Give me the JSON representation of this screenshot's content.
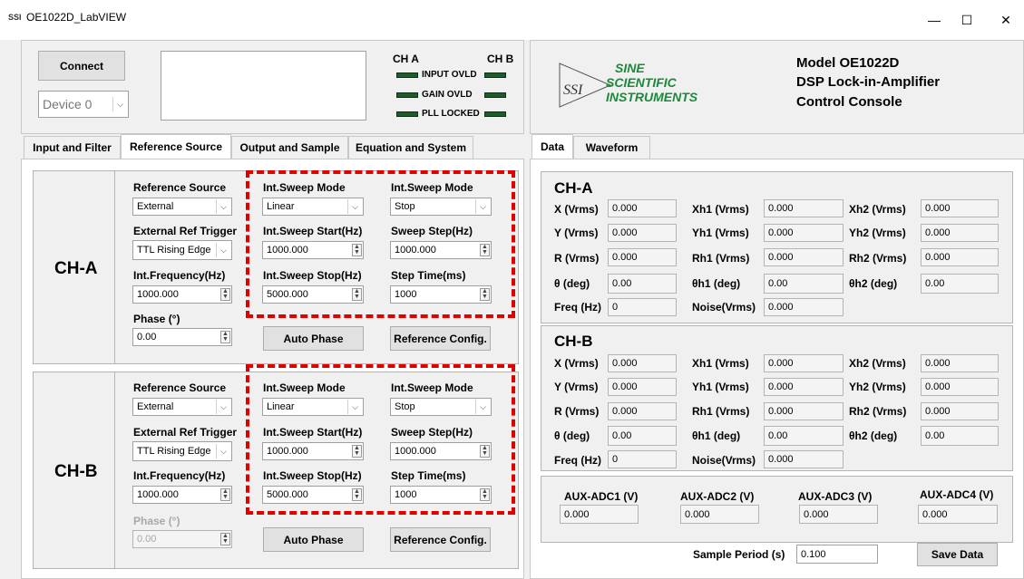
{
  "window": {
    "icon_text": "SSI",
    "title": "OE1022D_LabVIEW",
    "minimize": "—",
    "maximize": "☐",
    "close": "✕"
  },
  "connection": {
    "connect_label": "Connect",
    "device_value": "Device 0"
  },
  "indicators": {
    "ch_a": "CH A",
    "ch_b": "CH B",
    "items": [
      "INPUT OVLD",
      "GAIN OVLD",
      "PLL LOCKED"
    ]
  },
  "brand": {
    "logo_mark": "SSI",
    "line1": "SINE",
    "line2": "SCIENTIFIC",
    "line3": "INSTRUMENTS",
    "model": "Model OE1022D",
    "desc": "DSP Lock-in-Amplifier",
    "console": "Control Console"
  },
  "left_tabs": [
    "Input and Filter",
    "Reference Source",
    "Output and Sample",
    "Equation and System"
  ],
  "right_tabs": [
    "Data",
    "Waveform"
  ],
  "reference": {
    "labels": {
      "ref_source": "Reference Source",
      "ext_trigger": "External Ref Trigger",
      "int_freq": "Int.Frequency(Hz)",
      "phase": "Phase (°)",
      "sweep_mode": "Int.Sweep Mode",
      "sweep_start": "Int.Sweep Start(Hz)",
      "sweep_stop": "Int.Sweep Stop(Hz)",
      "sweep_step": "Sweep Step(Hz)",
      "step_time": "Step Time(ms)",
      "auto_phase": "Auto Phase",
      "ref_config": "Reference Config."
    },
    "channels": [
      {
        "name": "CH-A",
        "ref_source": "External",
        "ext_trigger": "TTL Rising Edge",
        "int_freq": "1000.000",
        "phase": "0.00",
        "sweep_mode1": "Linear",
        "sweep_mode2": "Stop",
        "sweep_start": "1000.000",
        "sweep_step": "1000.000",
        "sweep_stop": "5000.000",
        "step_time": "1000"
      },
      {
        "name": "CH-B",
        "ref_source": "External",
        "ext_trigger": "TTL Rising Edge",
        "int_freq": "1000.000",
        "phase": "0.00",
        "sweep_mode1": "Linear",
        "sweep_mode2": "Stop",
        "sweep_start": "1000.000",
        "sweep_step": "1000.000",
        "sweep_stop": "5000.000",
        "step_time": "1000"
      }
    ]
  },
  "data": {
    "labels": {
      "x": "X (Vrms)",
      "y": "Y (Vrms)",
      "r": "R (Vrms)",
      "theta": "θ (deg)",
      "freq": "Freq (Hz)",
      "xh1": "Xh1 (Vrms)",
      "yh1": "Yh1 (Vrms)",
      "rh1": "Rh1 (Vrms)",
      "th1": "θh1 (deg)",
      "noise": "Noise(Vrms)",
      "xh2": "Xh2 (Vrms)",
      "yh2": "Yh2 (Vrms)",
      "rh2": "Rh2 (Vrms)",
      "th2": "θh2 (deg)"
    },
    "channels": [
      {
        "name": "CH-A",
        "x": "0.000",
        "y": "0.000",
        "r": "0.000",
        "theta": "0.00",
        "freq": "0",
        "xh1": "0.000",
        "yh1": "0.000",
        "rh1": "0.000",
        "th1": "0.00",
        "noise": "0.000",
        "xh2": "0.000",
        "yh2": "0.000",
        "rh2": "0.000",
        "th2": "0.00"
      },
      {
        "name": "CH-B",
        "x": "0.000",
        "y": "0.000",
        "r": "0.000",
        "theta": "0.00",
        "freq": "0",
        "xh1": "0.000",
        "yh1": "0.000",
        "rh1": "0.000",
        "th1": "0.00",
        "noise": "0.000",
        "xh2": "0.000",
        "yh2": "0.000",
        "rh2": "0.000",
        "th2": "0.00"
      }
    ],
    "aux": [
      {
        "label": "AUX-ADC1 (V)",
        "value": "0.000"
      },
      {
        "label": "AUX-ADC2 (V)",
        "value": "0.000"
      },
      {
        "label": "AUX-ADC3 (V)",
        "value": "0.000"
      },
      {
        "label": "AUX-ADC4 (V)",
        "value": "0.000"
      }
    ],
    "sample_period_label": "Sample Period (s)",
    "sample_period_value": "0.100",
    "save_label": "Save Data"
  },
  "colors": {
    "led_on": "#1e5c2a",
    "highlight": "#e00000",
    "logo_green": "#1a8a3a"
  }
}
